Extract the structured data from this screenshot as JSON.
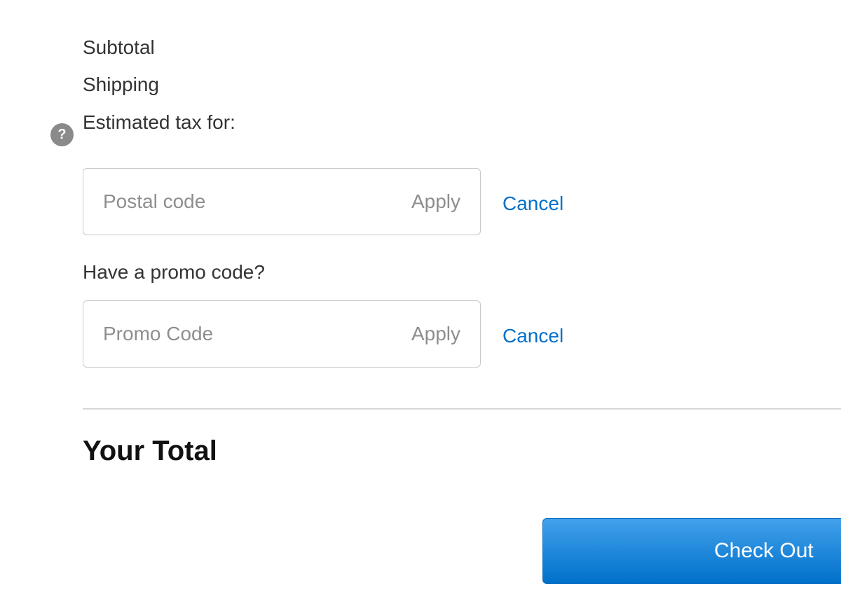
{
  "summary": {
    "subtotal_label": "Subtotal",
    "shipping_label": "Shipping",
    "tax_label": "Estimated tax for:",
    "help_icon": "?"
  },
  "postal": {
    "placeholder": "Postal code",
    "value": "",
    "apply_label": "Apply",
    "cancel_label": "Cancel"
  },
  "promo": {
    "question": "Have a promo code?",
    "placeholder": "Promo Code",
    "value": "",
    "apply_label": "Apply",
    "cancel_label": "Cancel"
  },
  "total": {
    "title": "Your Total"
  },
  "checkout": {
    "label": "Check Out"
  },
  "colors": {
    "link": "#0070c9",
    "button_top": "#42a1ec",
    "button_bottom": "#0070c9",
    "help_icon_bg": "#8a8a8a"
  },
  "icons": {
    "help": "question-circle-icon"
  }
}
